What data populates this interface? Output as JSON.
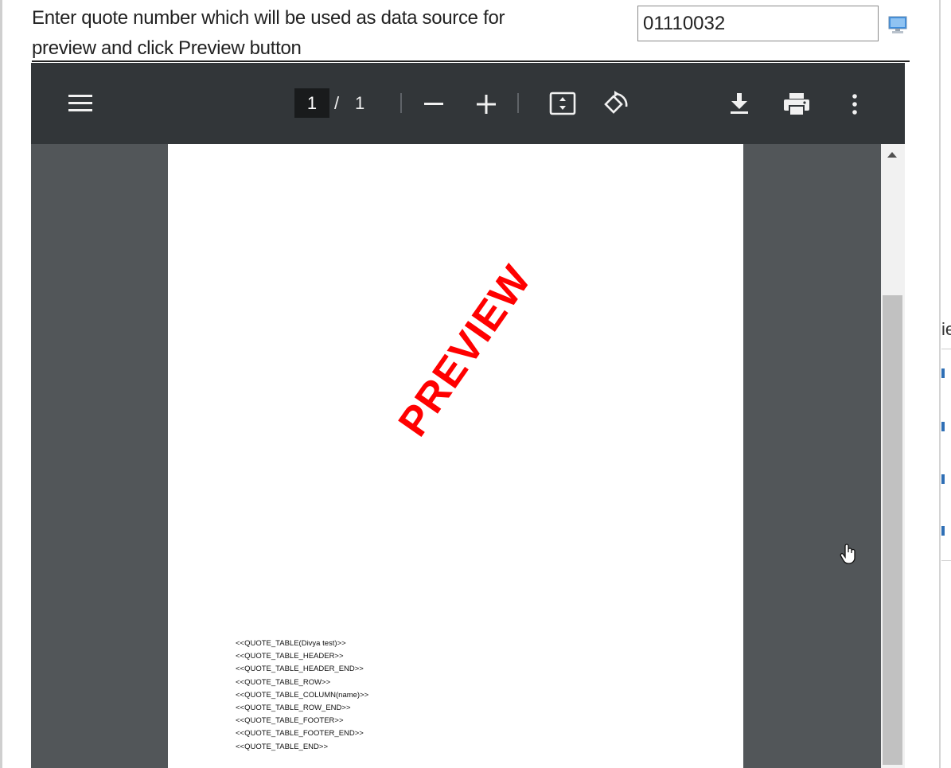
{
  "instruction": {
    "line1": "Enter quote number which will be used as data source for",
    "line2": "preview and click Preview button"
  },
  "quote_input": {
    "value": "01110032"
  },
  "preview_button": {
    "icon": "monitor-icon",
    "color": "#3c8dde"
  },
  "pdf_viewer": {
    "toolbar": {
      "menu_icon": "hamburger-menu-icon",
      "current_page": "1",
      "page_separator": "/",
      "total_pages": "1",
      "zoom_out_icon": "minus-icon",
      "zoom_in_icon": "plus-icon",
      "fit_icon": "fit-to-page-icon",
      "rotate_icon": "rotate-icon",
      "download_icon": "download-icon",
      "print_icon": "print-icon",
      "more_icon": "more-vertical-icon"
    },
    "page": {
      "watermark": "PREVIEW",
      "watermark_color": "#ff0000",
      "lines": [
        "<<QUOTE_TABLE(Divya test)>>",
        "<<QUOTE_TABLE_HEADER>>",
        "<<QUOTE_TABLE_HEADER_END>>",
        "<<QUOTE_TABLE_ROW>>",
        "<<QUOTE_TABLE_COLUMN(name)>>",
        "<<QUOTE_TABLE_ROW_END>>",
        "<<QUOTE_TABLE_FOOTER>>",
        "<<QUOTE_TABLE_FOOTER_END>>",
        "<<QUOTE_TABLE_END>>"
      ]
    }
  },
  "side_fragment": {
    "text": "ie"
  },
  "colors": {
    "toolbar_bg": "#323639",
    "viewer_bg": "#525659"
  }
}
